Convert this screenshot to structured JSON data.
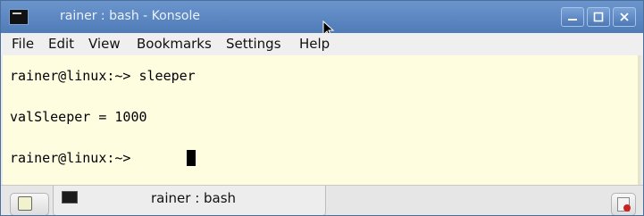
{
  "window": {
    "title": "rainer : bash - Konsole",
    "icons": {
      "app": "terminal-icon",
      "minimize": "minimize-icon",
      "maximize": "maximize-icon",
      "close": "close-icon"
    }
  },
  "menu": {
    "file": "File",
    "edit": "Edit",
    "view": "View",
    "bookmarks": "Bookmarks",
    "settings": "Settings",
    "help": "Help"
  },
  "terminal": {
    "lines": [
      "rainer@linux:~> sleeper",
      "valSleeper = 1000",
      "rainer@linux:~> "
    ],
    "background": "#fffde0",
    "foreground": "#000000"
  },
  "tabs": {
    "active_label": "rainer : bash",
    "icons": {
      "new_tab": "new-tab-icon",
      "tab": "terminal-icon",
      "close_tab": "close-tab-icon"
    }
  },
  "colors": {
    "titlebar": "#5a86c2",
    "menubar": "#efefef",
    "tabbar": "#e6e6e6"
  }
}
